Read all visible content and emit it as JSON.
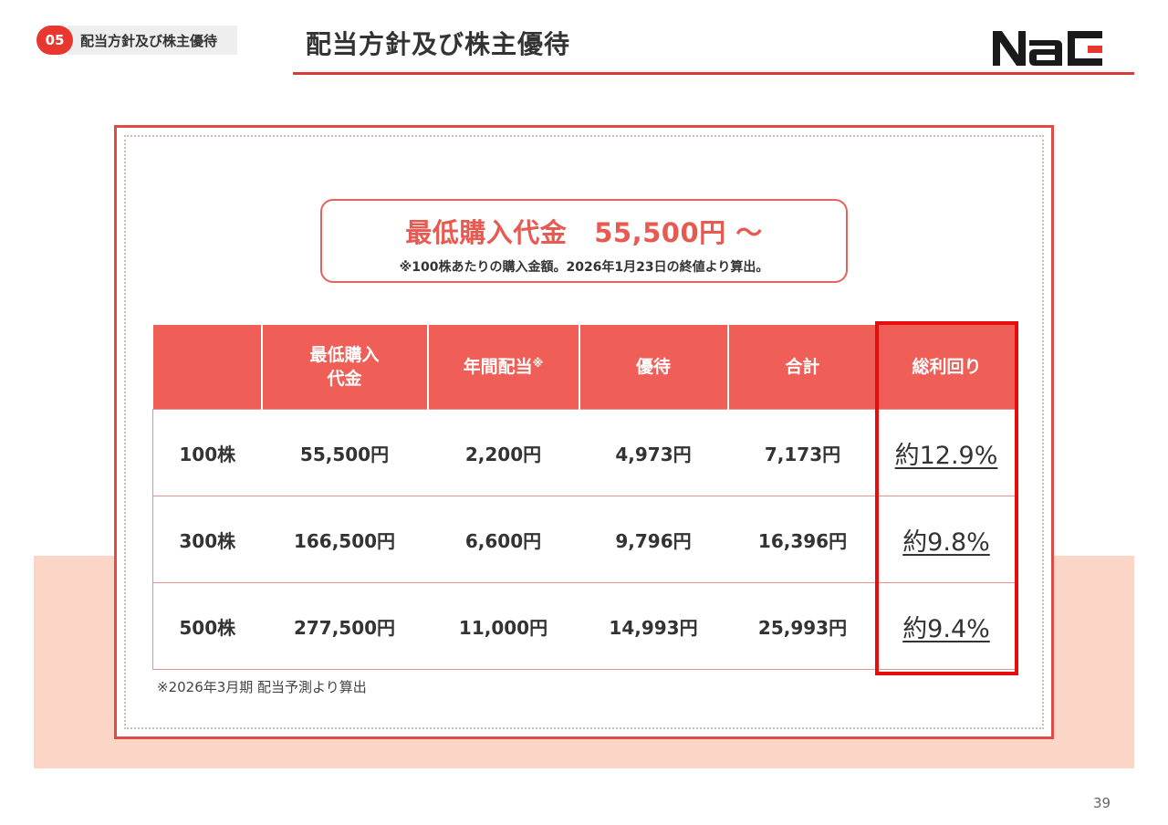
{
  "header": {
    "section_number": "05",
    "section_label": "配当方針及び株主優待",
    "title": "配当方針及び株主優待"
  },
  "colors": {
    "accent_red": "#e8372f",
    "table_header": "#ef5f57",
    "highlight_border": "#e80d0d",
    "band_pink": "#fbd5c5"
  },
  "price_box": {
    "title": "最低購入代金",
    "amount": "55,500円 ～",
    "note": "※100株あたりの購入金額。2026年1月23日の終値より算出。"
  },
  "table": {
    "headers": [
      {
        "line1": "",
        "line2": ""
      },
      {
        "line1": "最低購入",
        "line2": "代金"
      },
      {
        "line1": "年間配当",
        "line2": ""
      },
      {
        "line1": "優待",
        "line2": ""
      },
      {
        "line1": "合計",
        "line2": ""
      },
      {
        "line1": "総利回り",
        "line2": ""
      }
    ],
    "dividend_mark": "※",
    "rows": [
      {
        "shares": "100株",
        "price": "55,500円",
        "dividend": "2,200円",
        "benefit": "4,973円",
        "total": "7,173円",
        "yield": "約12.9%"
      },
      {
        "shares": "300株",
        "price": "166,500円",
        "dividend": "6,600円",
        "benefit": "9,796円",
        "total": "16,396円",
        "yield": "約9.8%"
      },
      {
        "shares": "500株",
        "price": "277,500円",
        "dividend": "11,000円",
        "benefit": "14,993円",
        "total": "25,993円",
        "yield": "約9.4%"
      }
    ]
  },
  "footnote": "※2026年3月期 配当予測より算出",
  "page_number": "39"
}
